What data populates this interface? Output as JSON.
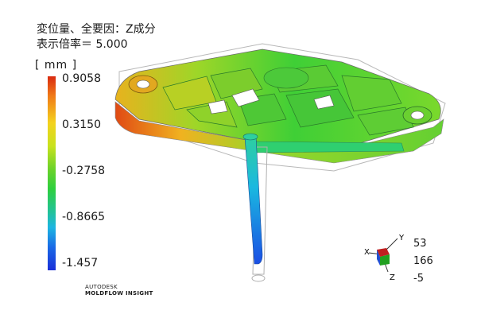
{
  "header": {
    "result_title": "変位量、全要因：Z成分",
    "scale_factor": "表示倍率＝ 5.000"
  },
  "legend": {
    "unit": "[ mm ]",
    "ticks": [
      "0.9058",
      "0.3150",
      "-0.2758",
      "-0.8665",
      "-1.457"
    ],
    "colors": {
      "max": "#d92a10",
      "mid": "#2ecf3e",
      "min": "#1a2fd8"
    }
  },
  "triad": {
    "x_label": "X",
    "y_label": "Y",
    "z_label": "Z"
  },
  "view_rotation": {
    "x": "53",
    "y": "166",
    "z": "-5"
  },
  "brand": {
    "line1": "AUTODESK",
    "line2": "MOLDFLOW  INSIGHT"
  }
}
